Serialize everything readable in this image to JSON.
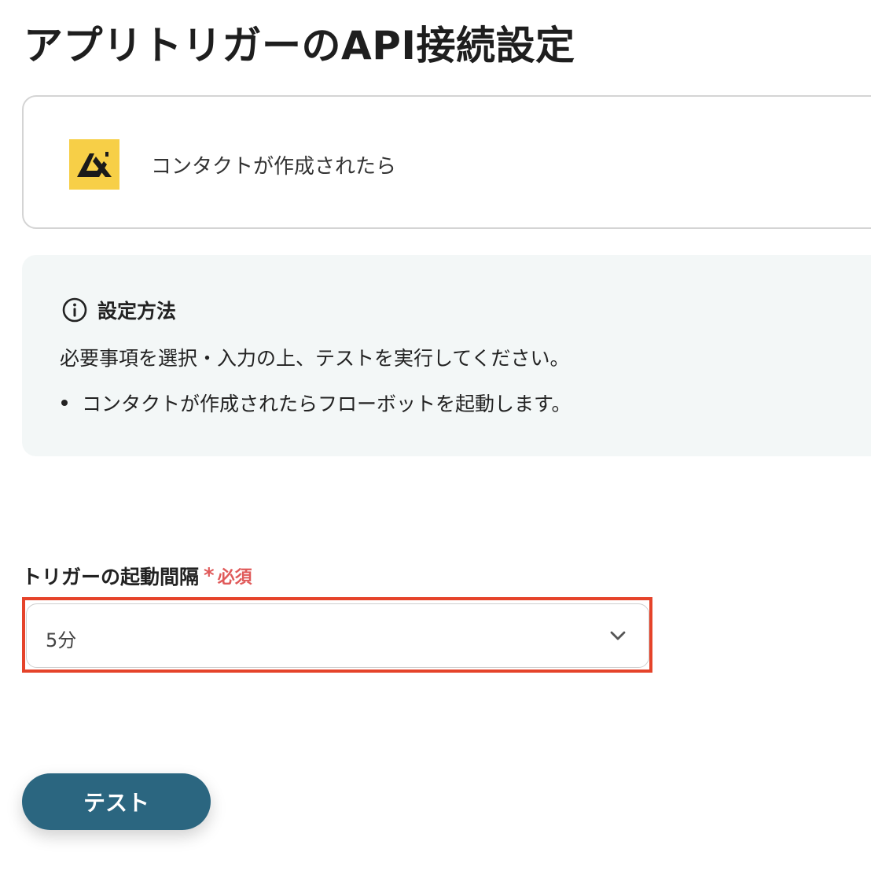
{
  "page_title": "アプリトリガーのAPI接続設定",
  "trigger_card": {
    "app_logo_icon": "app-logo-icon",
    "trigger_name": "コンタクトが作成されたら",
    "logo_color": "#f7cf47"
  },
  "info": {
    "icon": "info-circle-icon",
    "title": "設定方法",
    "description": "必要事項を選択・入力の上、テストを実行してください。",
    "bullets": [
      "コンタクトが作成されたらフローボットを起動します。"
    ]
  },
  "interval_field": {
    "label": "トリガーの起動間隔",
    "required_mark": "*",
    "required_text": "必須",
    "selected_value": "5分",
    "dropdown_icon": "chevron-down-icon"
  },
  "actions": {
    "test_label": "テスト"
  },
  "colors": {
    "primary_button": "#2b6680",
    "required": "#e05a5a",
    "highlight": "#e5432a",
    "info_background": "#f3f7f7"
  }
}
